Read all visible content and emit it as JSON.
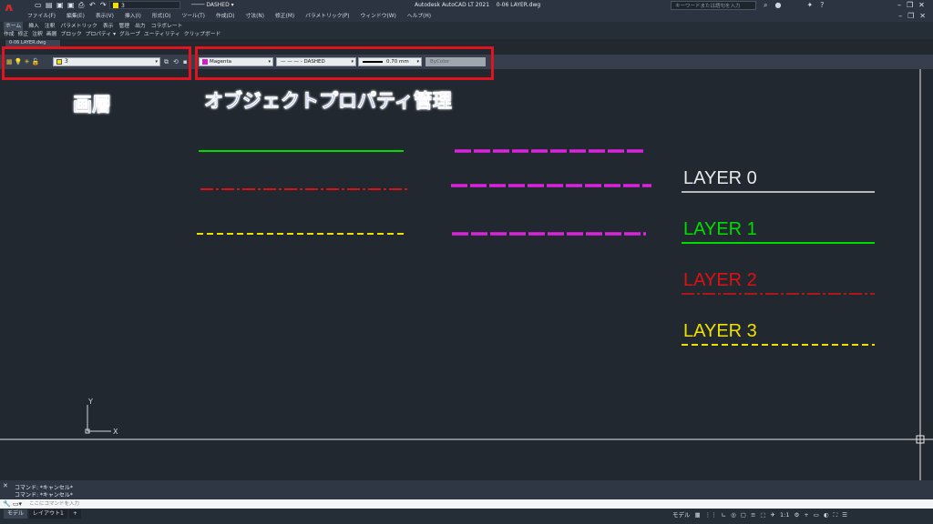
{
  "titlebar": {
    "app_title": "Autodesk AutoCAD LT 2021",
    "file_name": "0-06 LAYER.dwg",
    "quick_layer": "3",
    "quick_linetype": "DASHED",
    "search_placeholder": "キーワードまたは語句を入力",
    "help_label": "?"
  },
  "menu": {
    "items": [
      "ファイル(F)",
      "編集(E)",
      "表示(V)",
      "挿入(I)",
      "形式(O)",
      "ツール(T)",
      "作成(D)",
      "寸法(N)",
      "修正(M)",
      "パラメトリック(P)",
      "ウィンドウ(W)",
      "ヘルプ(H)"
    ]
  },
  "ribbon": {
    "tabs": [
      "ホーム",
      "挿入",
      "注釈",
      "パラメトリック",
      "表示",
      "管理",
      "出力",
      "コラボレート"
    ],
    "panels": [
      "作成",
      "修正",
      "注釈",
      "画層",
      "ブロック",
      "プロパティ ▾",
      "グループ",
      "ユーティリティ",
      "クリップボード"
    ]
  },
  "layer_toolbar": {
    "current_layer": "3",
    "layer_color": "#f5e400"
  },
  "properties_toolbar": {
    "color": "Magenta",
    "color_swatch": "#cc22cc",
    "linetype": "— — — - DASHED",
    "lineweight": "0.70 mm",
    "plot_style": "ByColor"
  },
  "annotations": {
    "layer_label": "画層",
    "properties_label": "オブジェクトプロパティ管理"
  },
  "legend": {
    "items": [
      {
        "label": "LAYER 0",
        "color": "#e8e8e8"
      },
      {
        "label": "LAYER 1",
        "color": "#00dd00"
      },
      {
        "label": "LAYER 2",
        "color": "#dd1111"
      },
      {
        "label": "LAYER 3",
        "color": "#f0e000"
      }
    ]
  },
  "ucs": {
    "x_label": "X",
    "y_label": "Y"
  },
  "command": {
    "history": [
      "コマンド: *キャンセル*",
      "コマンド: *キャンセル*"
    ],
    "placeholder": "ここにコマンドを入力"
  },
  "status": {
    "tabs": [
      "モデル",
      "レイアウト1",
      "+"
    ],
    "model_label": "モデル",
    "scale": "1:1"
  }
}
